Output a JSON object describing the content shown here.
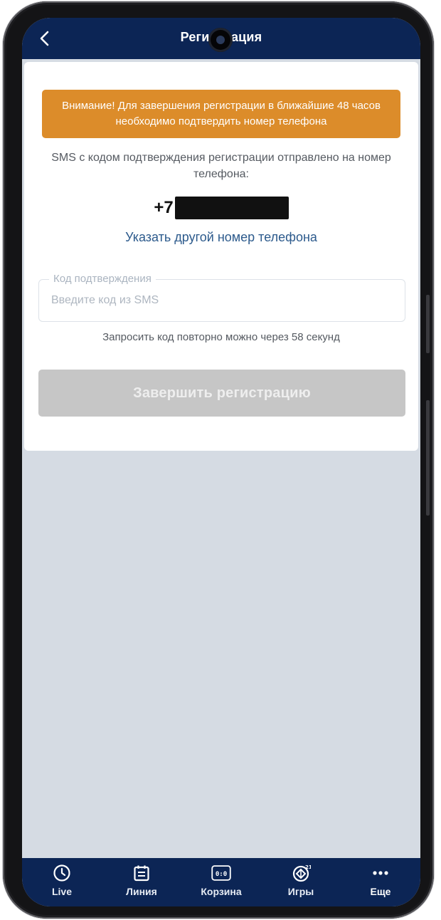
{
  "header": {
    "title": "Регистрация",
    "back_icon": "chevron-left-icon"
  },
  "card": {
    "warning": "Внимание! Для завершения регистрации в ближайшие 48 часов необходимо подтвердить номер телефона",
    "sms_info": "SMS с кодом подтверждения регистрации отправлено на номер телефона:",
    "phone_prefix": "+7",
    "change_phone_link": "Указать другой номер телефона",
    "code_field": {
      "label": "Код подтверждения",
      "placeholder": "Введите код из SMS",
      "value": ""
    },
    "resend_text": "Запросить код повторно можно через 58 секунд",
    "submit_label": "Завершить регистрацию"
  },
  "bottom_nav": {
    "items": [
      {
        "label": "Live",
        "icon": "clock-icon"
      },
      {
        "label": "Линия",
        "icon": "calendar-icon"
      },
      {
        "label": "Корзина",
        "icon": "coupon-icon"
      },
      {
        "label": "Игры",
        "icon": "games-icon"
      },
      {
        "label": "Еще",
        "icon": "more-icon"
      }
    ]
  },
  "colors": {
    "primary": "#0c2555",
    "warning": "#dc8c2a",
    "link": "#2c5a8c",
    "disabled_button": "#c6c6c6",
    "background": "#d5dbe3"
  }
}
